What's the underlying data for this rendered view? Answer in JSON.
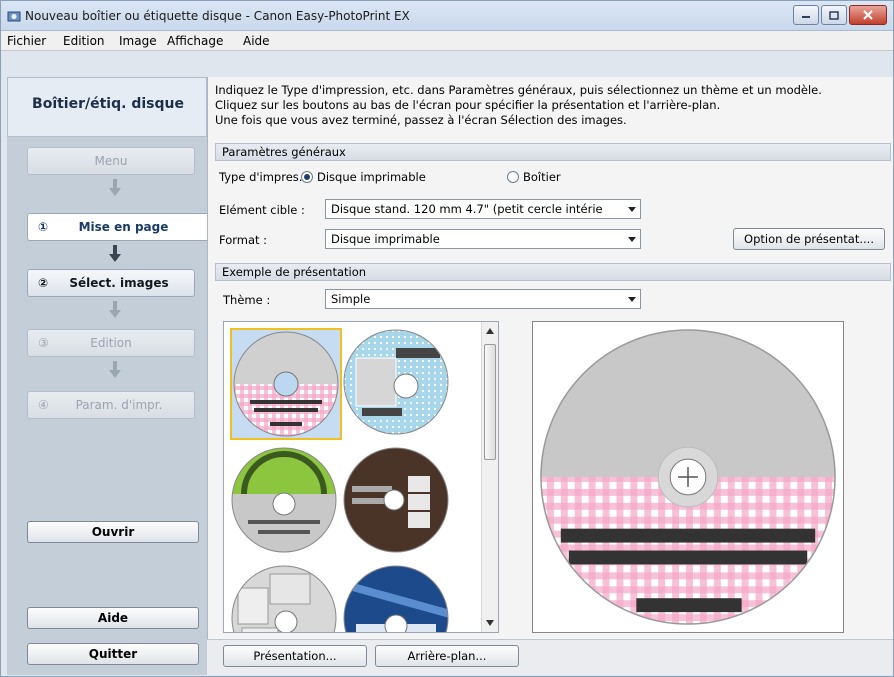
{
  "window": {
    "title": "Nouveau boîtier ou étiquette disque - Canon Easy-PhotoPrint EX"
  },
  "menu": [
    "Fichier",
    "Edition",
    "Image",
    "Affichage",
    "Aide"
  ],
  "sidebar": {
    "header": "Boîtier/étiq. disque",
    "steps": [
      {
        "num": "",
        "label": "Menu",
        "state": "disabled"
      },
      {
        "num": "①",
        "label": "Mise en page",
        "state": "current"
      },
      {
        "num": "②",
        "label": "Sélect. images",
        "state": "enabled"
      },
      {
        "num": "③",
        "label": "Edition",
        "state": "disabled"
      },
      {
        "num": "④",
        "label": "Param. d'impr.",
        "state": "disabled"
      }
    ],
    "open_label": "Ouvrir",
    "help_label": "Aide",
    "quit_label": "Quitter"
  },
  "instructions": [
    "Indiquez le Type d'impression, etc. dans Paramètres généraux, puis sélectionnez un thème et un modèle.",
    "Cliquez sur les boutons au bas de l'écran pour spécifier la présentation et l'arrière-plan.",
    "Une fois que vous avez terminé, passez à l'écran Sélection des images."
  ],
  "general": {
    "section_title": "Paramètres généraux",
    "print_type_label": "Type d'impres. :",
    "print_type_options": [
      "Disque imprimable",
      "Boîtier"
    ],
    "print_type_selected": "Disque imprimable",
    "target_label": "Elément cible :",
    "target_value": "Disque stand. 120 mm 4.7\" (petit cercle intérie",
    "format_label": "Format :",
    "format_value": "Disque imprimable",
    "layout_option_label": "Option de présentat...."
  },
  "layout": {
    "section_title": "Exemple de présentation",
    "theme_label": "Thème :",
    "theme_value": "Simple"
  },
  "bottom": {
    "presentation_label": "Présentation...",
    "background_label": "Arrière-plan..."
  },
  "colors": {
    "accent": "#1c2e4a",
    "selection": "#f0c020",
    "gingham": "#f4a7c8"
  }
}
